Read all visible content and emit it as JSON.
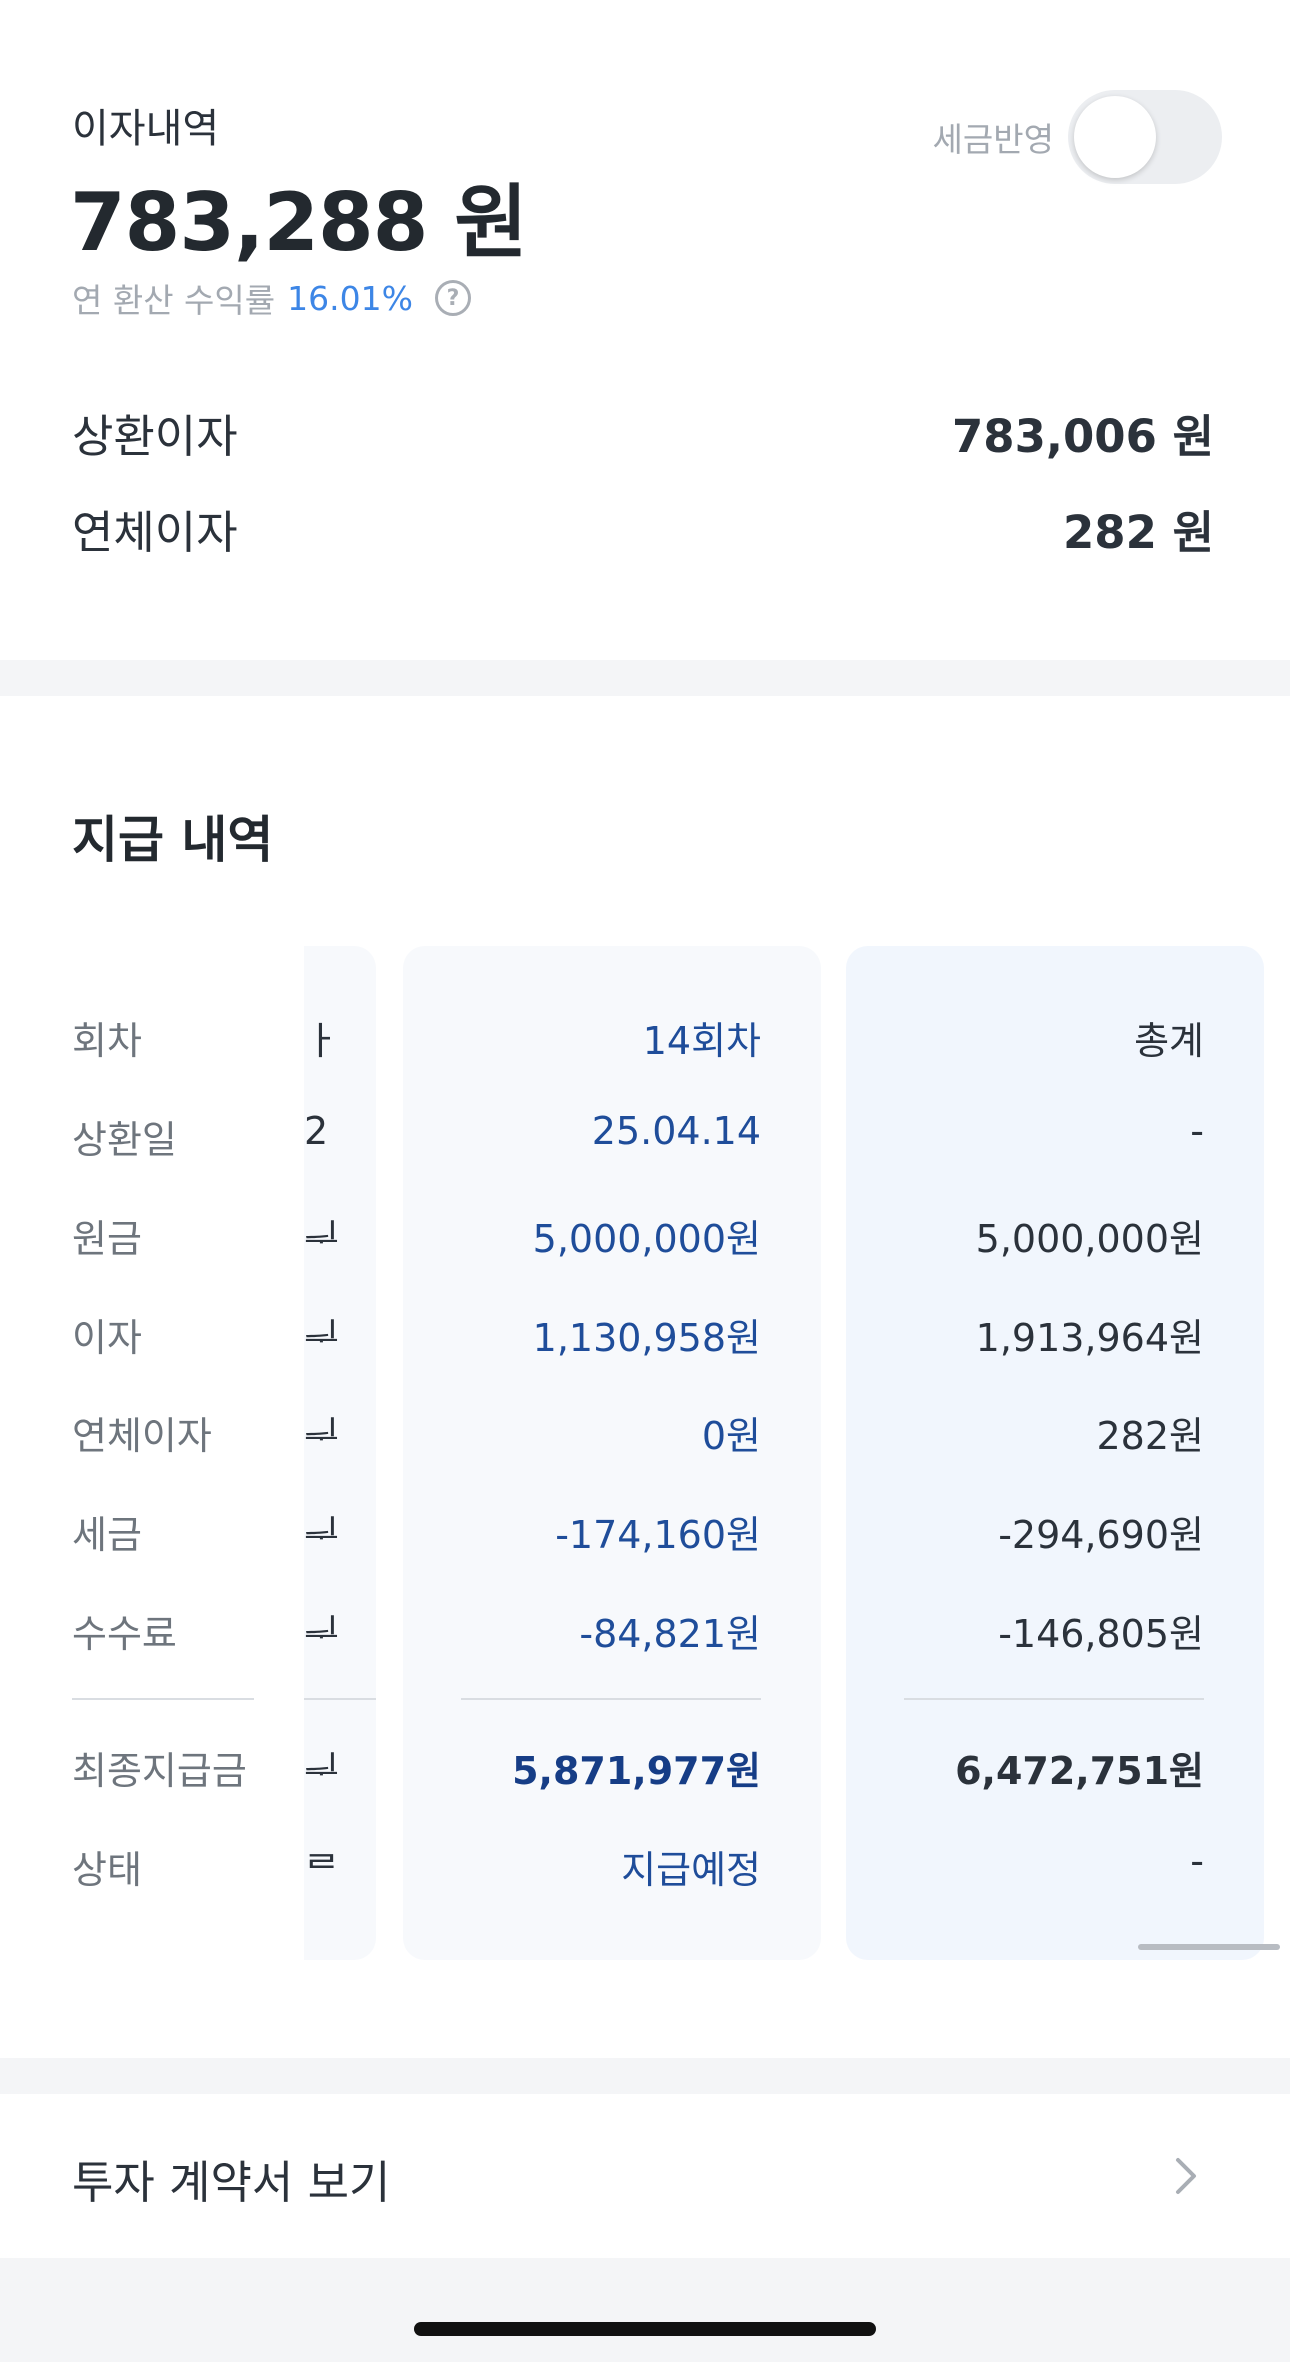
{
  "interest": {
    "label": "이자내역",
    "total": "783,288 원",
    "yield_label": "연 환산 수익률",
    "yield_rate": "16.01%",
    "help_glyph": "?",
    "tax_label": "세금반영",
    "tax_toggle_on": false,
    "rows": [
      {
        "key": "상환이자",
        "value": "783,006 원"
      },
      {
        "key": "연체이자",
        "value": "282 원"
      }
    ]
  },
  "payment": {
    "title": "지급 내역",
    "row_labels": [
      "회차",
      "상환일",
      "원금",
      "이자",
      "연체이자",
      "세금",
      "수수료",
      "최종지급금",
      "상태"
    ],
    "partial_column": [
      "ㅏ",
      "2",
      "ᆗ",
      "ᆗ",
      "ᆗ",
      "ᆗ",
      "ᆗ",
      "ᆗ",
      "ᄅ"
    ],
    "columns": [
      {
        "id": "round-14",
        "values": [
          "14회차",
          "25.04.14",
          "5,000,000원",
          "1,130,958원",
          "0원",
          "-174,160원",
          "-84,821원",
          "5,871,977원",
          "지급예정"
        ]
      },
      {
        "id": "total",
        "values": [
          "총계",
          "-",
          "5,000,000원",
          "1,913,964원",
          "282원",
          "-294,690원",
          "-146,805원",
          "6,472,751원",
          "-"
        ]
      }
    ]
  },
  "contract": {
    "label": "투자 계약서 보기"
  },
  "colors": {
    "accent_blue": "#3d86e6",
    "column_text_blue": "#1f4d9a",
    "total_column_bg": "#f1f6fd"
  },
  "icons": {
    "help": "question-circle-icon",
    "chevron": "chevron-right-icon"
  }
}
